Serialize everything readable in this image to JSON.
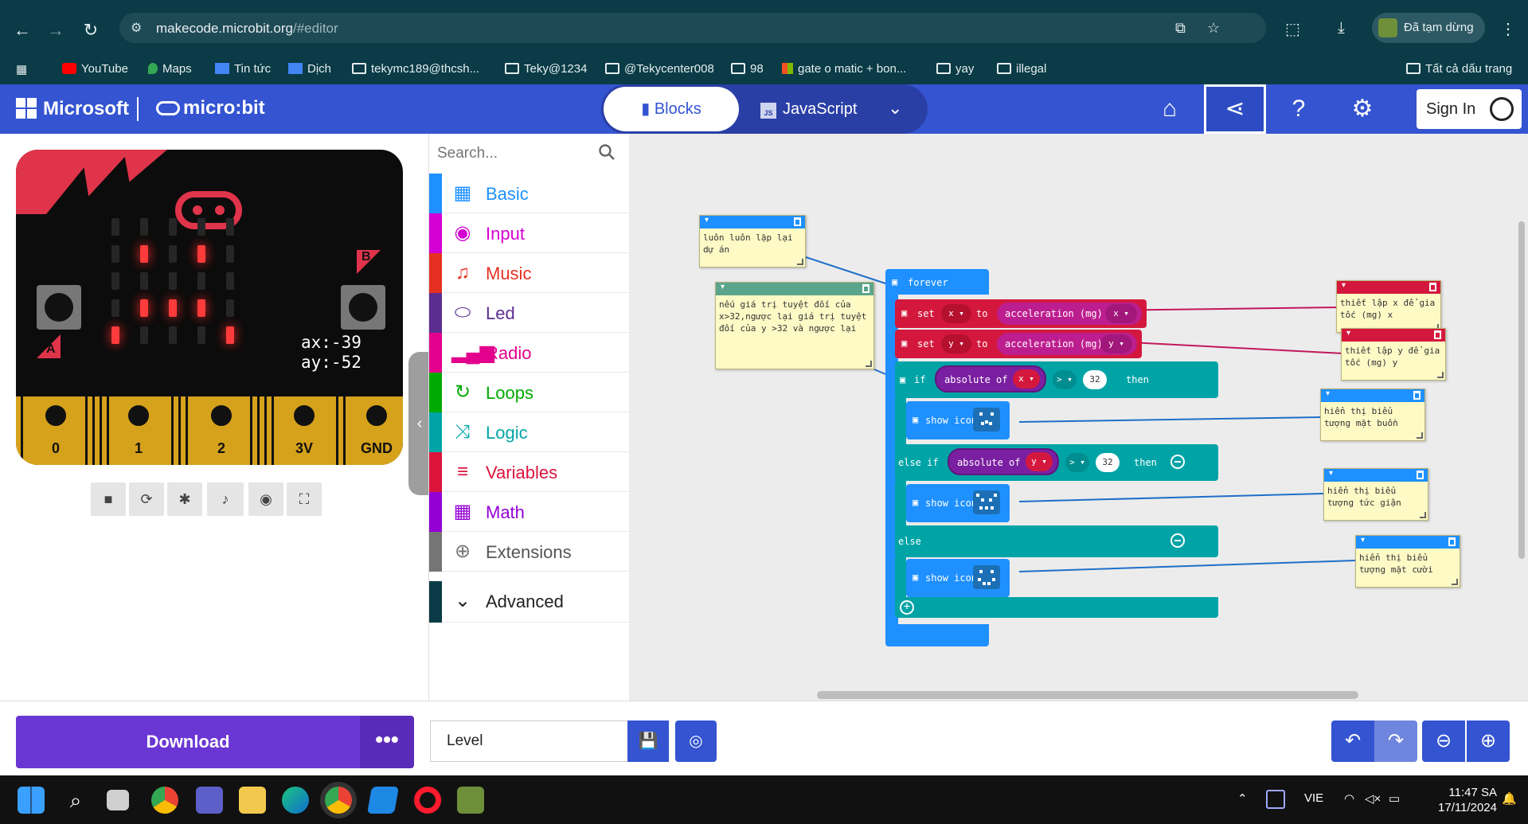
{
  "browser": {
    "url_host": "makecode.microbit.org",
    "url_path": "/#editor",
    "profile_label": "Đã tạm dừng",
    "bookmarks": [
      {
        "label": "YouTube",
        "icon": "youtube-icon"
      },
      {
        "label": "Maps",
        "icon": "maps-icon"
      },
      {
        "label": "Tin tức",
        "icon": "news-icon"
      },
      {
        "label": "Dịch",
        "icon": "translate-icon"
      },
      {
        "label": "tekymc189@thcsh...",
        "icon": "folder-icon"
      },
      {
        "label": "Teky@1234",
        "icon": "folder-icon"
      },
      {
        "label": "@Tekycenter008",
        "icon": "folder-icon"
      },
      {
        "label": "98",
        "icon": "folder-icon"
      },
      {
        "label": "gate o matic + bon...",
        "icon": "microsoft-icon"
      },
      {
        "label": "yay",
        "icon": "folder-icon"
      },
      {
        "label": "illegal",
        "icon": "folder-icon"
      }
    ],
    "all_bookmarks_label": "Tất cả dấu trang"
  },
  "header": {
    "brand": "Microsoft",
    "product": "micro:bit",
    "tab_blocks": "Blocks",
    "tab_js": "JavaScript",
    "js_badge": "JS",
    "sign_in": "Sign In",
    "accent": "#3454d1"
  },
  "simulator": {
    "accel_x": "ax:-39",
    "accel_y": "ay:-52",
    "pins": [
      "0",
      "1",
      "2",
      "3V",
      "GND"
    ],
    "button_a": "A",
    "button_b": "B"
  },
  "toolbox": {
    "search_placeholder": "Search...",
    "categories": [
      {
        "label": "Basic",
        "color": "#1e90ff",
        "icon": "grid-icon"
      },
      {
        "label": "Input",
        "color": "#d400d4",
        "icon": "target-icon"
      },
      {
        "label": "Music",
        "color": "#e63022",
        "icon": "headphones-icon"
      },
      {
        "label": "Led",
        "color": "#5c2d91",
        "icon": "toggle-icon"
      },
      {
        "label": "Radio",
        "color": "#e3008c",
        "icon": "signal-icon"
      },
      {
        "label": "Loops",
        "color": "#00aa00",
        "icon": "loop-icon"
      },
      {
        "label": "Logic",
        "color": "#00a4a6",
        "icon": "shuffle-icon"
      },
      {
        "label": "Variables",
        "color": "#dc143c",
        "icon": "lines-icon"
      },
      {
        "label": "Math",
        "color": "#9400d3",
        "icon": "calculator-icon"
      },
      {
        "label": "Extensions",
        "color": "#757575",
        "icon": "plus-icon"
      }
    ],
    "advanced_label": "Advanced"
  },
  "workspace": {
    "comments": {
      "forever": "luôn luôn lặp lại dự án",
      "if_logic": "nếu giá trị tuyệt đối của x>32,ngược lại giá trị tuyệt đối của y >32 và ngược lại",
      "set_x": "thiết lập x để gia tốc (mg) x",
      "set_y": "thiết lập y để gia tốc (mg) y",
      "sad": "hiển thị biểu tượng mặt buồn",
      "angry": "hiển thị biểu tượng tức giận",
      "happy": "hiển thị biểu tượng mặt cười"
    },
    "blocks": {
      "forever": "forever",
      "set_kw": "set",
      "to_kw": "to",
      "var_x": "x",
      "var_y": "y",
      "accel_label": "acceleration (mg)",
      "if_kw": "if",
      "else_if_kw": "else if",
      "else_kw": "else",
      "then_kw": "then",
      "abs_label": "absolute of",
      "gt_op": ">",
      "threshold": "32",
      "show_icon": "show icon"
    }
  },
  "bottom": {
    "download": "Download",
    "more": "•••",
    "project_name": "Level"
  },
  "taskbar": {
    "lang": "VIE",
    "time": "11:47 SA",
    "date": "17/11/2024"
  }
}
